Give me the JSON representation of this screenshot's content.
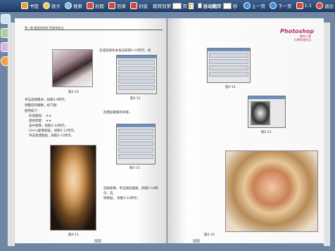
{
  "toolbar": {
    "bookmark": "书签",
    "zoom_in": "放大",
    "search": "搜索",
    "cover": "封面",
    "toc": "目录",
    "back_cover": "封底",
    "jump_label": "跳转到第",
    "jump_value": "",
    "page_unit": "页",
    "auto_turn": "自动翻页",
    "auto_value": "",
    "seconds": "秒",
    "prev": "上一页",
    "next": "下一页",
    "fit": "1:1",
    "exit": "退出"
  },
  "left_page": {
    "running_head": "第一章  眼部的修饰  PS修饰技法",
    "fig1": "图3-10",
    "fig2": "图3-12",
    "fig3": "图3-13",
    "fig4": "图3-11",
    "text1": "生成后颜色本身应如图3-12所示；如",
    "text2": "的图层蒙版的效果。",
    "text3": "调整后的眼睛，如下图：",
    "text4": "单击选择模式，如图3-9所示，",
    "list_title": "使用如下：",
    "list1_label": "形成素描：",
    "list1_value": "★★",
    "list2_label": "基色明度：",
    "list2_value": "★★",
    "list3": "选中图像，如图3-10所示。",
    "list4": "Ctrl+J复制图层，如图3-11所示。",
    "list5": "单击新建图层，如图3-13所示。",
    "text5": "选择图像，单击图层面板。如图3-14所示，选",
    "text6": "择图层。 如图3-13所示。"
  },
  "right_page": {
    "logo": "Photoshop",
    "logo_sub_1": "数码人像",
    "logo_sub_2": "后期处理技法",
    "fig1": "图3-14",
    "fig2": "图3-15",
    "fig3": "图3-16"
  }
}
